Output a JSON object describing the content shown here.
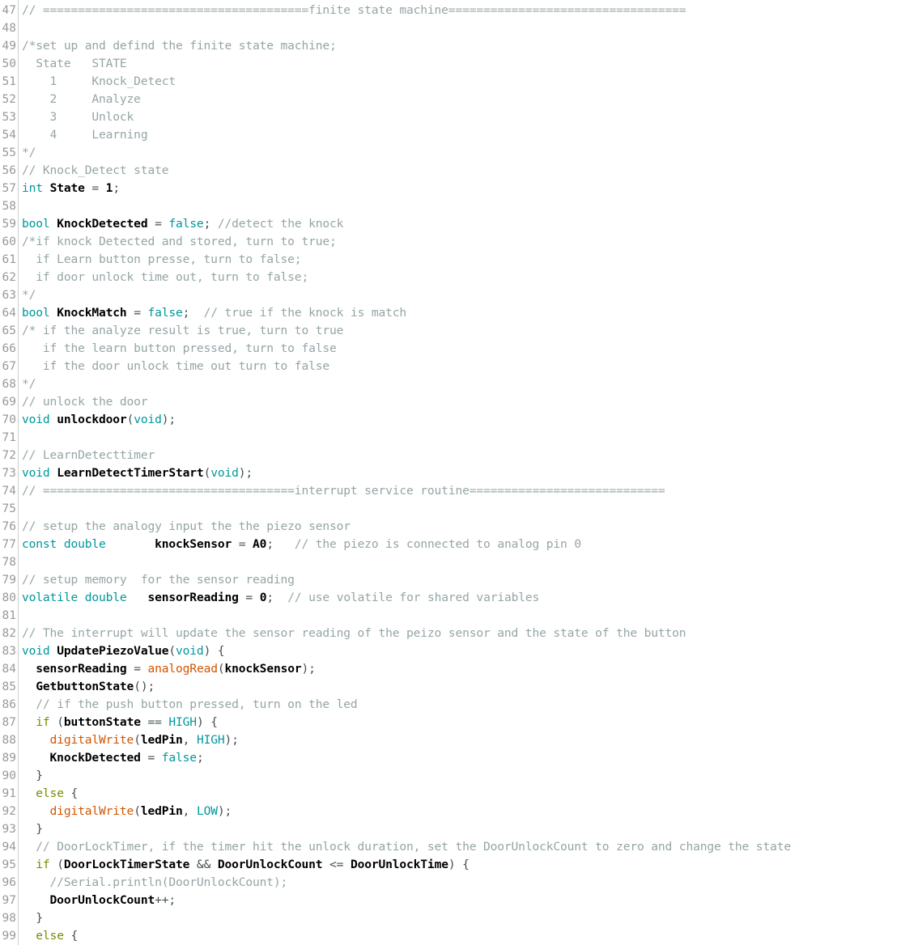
{
  "editor": {
    "name": "arduino-code-editor",
    "language": "C++ (Arduino)",
    "first_line": 47,
    "last_line": 99,
    "colors": {
      "background": "#ffffff",
      "gutter_text": "#999999",
      "gutter_border": "#cfcfcf",
      "comment": "#95a5a6",
      "keyword": "#00979c",
      "literal": "#00979c",
      "function": "#d35400",
      "control": "#728e00",
      "identifier": "#000000",
      "operator": "#434f54"
    }
  },
  "lines": [
    {
      "n": "47",
      "tokens": [
        {
          "t": "// ======================================finite state machine==================================",
          "c": "cmt"
        }
      ]
    },
    {
      "n": "48",
      "tokens": []
    },
    {
      "n": "49",
      "tokens": [
        {
          "t": "/*set up and defind the finite state machine;",
          "c": "cmt"
        }
      ]
    },
    {
      "n": "50",
      "tokens": [
        {
          "t": "  State   STATE",
          "c": "cmt"
        }
      ]
    },
    {
      "n": "51",
      "tokens": [
        {
          "t": "    1     Knock_Detect",
          "c": "cmt"
        }
      ]
    },
    {
      "n": "52",
      "tokens": [
        {
          "t": "    2     Analyze",
          "c": "cmt"
        }
      ]
    },
    {
      "n": "53",
      "tokens": [
        {
          "t": "    3     Unlock",
          "c": "cmt"
        }
      ]
    },
    {
      "n": "54",
      "tokens": [
        {
          "t": "    4     Learning",
          "c": "cmt"
        }
      ]
    },
    {
      "n": "55",
      "tokens": [
        {
          "t": "*/",
          "c": "cmt"
        }
      ]
    },
    {
      "n": "56",
      "tokens": [
        {
          "t": "// Knock_Detect state",
          "c": "cmt"
        }
      ]
    },
    {
      "n": "57",
      "tokens": [
        {
          "t": "int",
          "c": "kw"
        },
        {
          "t": " ",
          "c": "op"
        },
        {
          "t": "State",
          "c": "id"
        },
        {
          "t": " = ",
          "c": "op"
        },
        {
          "t": "1",
          "c": "num"
        },
        {
          "t": ";",
          "c": "op"
        }
      ]
    },
    {
      "n": "58",
      "tokens": []
    },
    {
      "n": "59",
      "tokens": [
        {
          "t": "bool",
          "c": "kw"
        },
        {
          "t": " ",
          "c": "op"
        },
        {
          "t": "KnockDetected",
          "c": "id"
        },
        {
          "t": " = ",
          "c": "op"
        },
        {
          "t": "false",
          "c": "lit"
        },
        {
          "t": "; ",
          "c": "op"
        },
        {
          "t": "//detect the knock",
          "c": "cmt"
        }
      ]
    },
    {
      "n": "60",
      "tokens": [
        {
          "t": "/*if knock Detected and stored, turn to true;",
          "c": "cmt"
        }
      ]
    },
    {
      "n": "61",
      "tokens": [
        {
          "t": "  if Learn button presse, turn to false;",
          "c": "cmt"
        }
      ]
    },
    {
      "n": "62",
      "tokens": [
        {
          "t": "  if door unlock time out, turn to false;",
          "c": "cmt"
        }
      ]
    },
    {
      "n": "63",
      "tokens": [
        {
          "t": "*/",
          "c": "cmt"
        }
      ]
    },
    {
      "n": "64",
      "tokens": [
        {
          "t": "bool",
          "c": "kw"
        },
        {
          "t": " ",
          "c": "op"
        },
        {
          "t": "KnockMatch",
          "c": "id"
        },
        {
          "t": " = ",
          "c": "op"
        },
        {
          "t": "false",
          "c": "lit"
        },
        {
          "t": ";  ",
          "c": "op"
        },
        {
          "t": "// true if the knock is match",
          "c": "cmt"
        }
      ]
    },
    {
      "n": "65",
      "tokens": [
        {
          "t": "/* if the analyze result is true, turn to true",
          "c": "cmt"
        }
      ]
    },
    {
      "n": "66",
      "tokens": [
        {
          "t": "   if the learn button pressed, turn to false",
          "c": "cmt"
        }
      ]
    },
    {
      "n": "67",
      "tokens": [
        {
          "t": "   if the door unlock time out turn to false",
          "c": "cmt"
        }
      ]
    },
    {
      "n": "68",
      "tokens": [
        {
          "t": "*/",
          "c": "cmt"
        }
      ]
    },
    {
      "n": "69",
      "tokens": [
        {
          "t": "// unlock the door",
          "c": "cmt"
        }
      ]
    },
    {
      "n": "70",
      "tokens": [
        {
          "t": "void",
          "c": "kw"
        },
        {
          "t": " ",
          "c": "op"
        },
        {
          "t": "unlockdoor",
          "c": "id"
        },
        {
          "t": "(",
          "c": "op"
        },
        {
          "t": "void",
          "c": "kw"
        },
        {
          "t": ");",
          "c": "op"
        }
      ]
    },
    {
      "n": "71",
      "tokens": []
    },
    {
      "n": "72",
      "tokens": [
        {
          "t": "// LearnDetecttimer",
          "c": "cmt"
        }
      ]
    },
    {
      "n": "73",
      "tokens": [
        {
          "t": "void",
          "c": "kw"
        },
        {
          "t": " ",
          "c": "op"
        },
        {
          "t": "LearnDetectTimerStart",
          "c": "id"
        },
        {
          "t": "(",
          "c": "op"
        },
        {
          "t": "void",
          "c": "kw"
        },
        {
          "t": ");",
          "c": "op"
        }
      ]
    },
    {
      "n": "74",
      "tokens": [
        {
          "t": "// ====================================interrupt service routine============================",
          "c": "cmt"
        }
      ]
    },
    {
      "n": "75",
      "tokens": []
    },
    {
      "n": "76",
      "tokens": [
        {
          "t": "// setup the analogy input the the piezo sensor",
          "c": "cmt"
        }
      ]
    },
    {
      "n": "77",
      "tokens": [
        {
          "t": "const",
          "c": "kw"
        },
        {
          "t": " ",
          "c": "op"
        },
        {
          "t": "double",
          "c": "kw"
        },
        {
          "t": "       ",
          "c": "op"
        },
        {
          "t": "knockSensor",
          "c": "id"
        },
        {
          "t": " = ",
          "c": "op"
        },
        {
          "t": "A0",
          "c": "id"
        },
        {
          "t": ";   ",
          "c": "op"
        },
        {
          "t": "// the piezo is connected to analog pin 0",
          "c": "cmt"
        }
      ]
    },
    {
      "n": "78",
      "tokens": []
    },
    {
      "n": "79",
      "tokens": [
        {
          "t": "// setup memory  for the sensor reading",
          "c": "cmt"
        }
      ]
    },
    {
      "n": "80",
      "tokens": [
        {
          "t": "volatile",
          "c": "kw"
        },
        {
          "t": " ",
          "c": "op"
        },
        {
          "t": "double",
          "c": "kw"
        },
        {
          "t": "   ",
          "c": "op"
        },
        {
          "t": "sensorReading",
          "c": "id"
        },
        {
          "t": " = ",
          "c": "op"
        },
        {
          "t": "0",
          "c": "num"
        },
        {
          "t": ";  ",
          "c": "op"
        },
        {
          "t": "// use volatile for shared variables",
          "c": "cmt"
        }
      ]
    },
    {
      "n": "81",
      "tokens": []
    },
    {
      "n": "82",
      "tokens": [
        {
          "t": "// The interrupt will update the sensor reading of the peizo sensor and the state of the button",
          "c": "cmt"
        }
      ]
    },
    {
      "n": "83",
      "tokens": [
        {
          "t": "void",
          "c": "kw"
        },
        {
          "t": " ",
          "c": "op"
        },
        {
          "t": "UpdatePiezoValue",
          "c": "id"
        },
        {
          "t": "(",
          "c": "op"
        },
        {
          "t": "void",
          "c": "kw"
        },
        {
          "t": ") {",
          "c": "op"
        }
      ]
    },
    {
      "n": "84",
      "tokens": [
        {
          "t": "  ",
          "c": "op"
        },
        {
          "t": "sensorReading",
          "c": "id"
        },
        {
          "t": " = ",
          "c": "op"
        },
        {
          "t": "analogRead",
          "c": "fn"
        },
        {
          "t": "(",
          "c": "op"
        },
        {
          "t": "knockSensor",
          "c": "id"
        },
        {
          "t": ");",
          "c": "op"
        }
      ]
    },
    {
      "n": "85",
      "tokens": [
        {
          "t": "  ",
          "c": "op"
        },
        {
          "t": "GetbuttonState",
          "c": "id"
        },
        {
          "t": "();",
          "c": "op"
        }
      ]
    },
    {
      "n": "86",
      "tokens": [
        {
          "t": "  ",
          "c": "op"
        },
        {
          "t": "// if the push button pressed, turn on the led",
          "c": "cmt"
        }
      ]
    },
    {
      "n": "87",
      "tokens": [
        {
          "t": "  ",
          "c": "op"
        },
        {
          "t": "if",
          "c": "ctl"
        },
        {
          "t": " (",
          "c": "op"
        },
        {
          "t": "buttonState",
          "c": "id"
        },
        {
          "t": " == ",
          "c": "op"
        },
        {
          "t": "HIGH",
          "c": "lit"
        },
        {
          "t": ") {",
          "c": "op"
        }
      ]
    },
    {
      "n": "88",
      "tokens": [
        {
          "t": "    ",
          "c": "op"
        },
        {
          "t": "digitalWrite",
          "c": "fn"
        },
        {
          "t": "(",
          "c": "op"
        },
        {
          "t": "ledPin",
          "c": "id"
        },
        {
          "t": ", ",
          "c": "op"
        },
        {
          "t": "HIGH",
          "c": "lit"
        },
        {
          "t": ");",
          "c": "op"
        }
      ]
    },
    {
      "n": "89",
      "tokens": [
        {
          "t": "    ",
          "c": "op"
        },
        {
          "t": "KnockDetected",
          "c": "id"
        },
        {
          "t": " = ",
          "c": "op"
        },
        {
          "t": "false",
          "c": "lit"
        },
        {
          "t": ";",
          "c": "op"
        }
      ]
    },
    {
      "n": "90",
      "tokens": [
        {
          "t": "  }",
          "c": "op"
        }
      ]
    },
    {
      "n": "91",
      "tokens": [
        {
          "t": "  ",
          "c": "op"
        },
        {
          "t": "else",
          "c": "ctl"
        },
        {
          "t": " {",
          "c": "op"
        }
      ]
    },
    {
      "n": "92",
      "tokens": [
        {
          "t": "    ",
          "c": "op"
        },
        {
          "t": "digitalWrite",
          "c": "fn"
        },
        {
          "t": "(",
          "c": "op"
        },
        {
          "t": "ledPin",
          "c": "id"
        },
        {
          "t": ", ",
          "c": "op"
        },
        {
          "t": "LOW",
          "c": "lit"
        },
        {
          "t": ");",
          "c": "op"
        }
      ]
    },
    {
      "n": "93",
      "tokens": [
        {
          "t": "  }",
          "c": "op"
        }
      ]
    },
    {
      "n": "94",
      "tokens": [
        {
          "t": "  ",
          "c": "op"
        },
        {
          "t": "// DoorLockTimer, if the timer hit the unlock duration, set the DoorUnlockCount to zero and change the state",
          "c": "cmt"
        }
      ]
    },
    {
      "n": "95",
      "tokens": [
        {
          "t": "  ",
          "c": "op"
        },
        {
          "t": "if",
          "c": "ctl"
        },
        {
          "t": " (",
          "c": "op"
        },
        {
          "t": "DoorLockTimerState",
          "c": "id"
        },
        {
          "t": " && ",
          "c": "op"
        },
        {
          "t": "DoorUnlockCount",
          "c": "id"
        },
        {
          "t": " <= ",
          "c": "op"
        },
        {
          "t": "DoorUnlockTime",
          "c": "id"
        },
        {
          "t": ") {",
          "c": "op"
        }
      ]
    },
    {
      "n": "96",
      "tokens": [
        {
          "t": "    ",
          "c": "op"
        },
        {
          "t": "//Serial.println(DoorUnlockCount);",
          "c": "cmt"
        }
      ]
    },
    {
      "n": "97",
      "tokens": [
        {
          "t": "    ",
          "c": "op"
        },
        {
          "t": "DoorUnlockCount",
          "c": "id"
        },
        {
          "t": "++;",
          "c": "op"
        }
      ]
    },
    {
      "n": "98",
      "tokens": [
        {
          "t": "  }",
          "c": "op"
        }
      ]
    },
    {
      "n": "99",
      "tokens": [
        {
          "t": "  ",
          "c": "op"
        },
        {
          "t": "else",
          "c": "ctl"
        },
        {
          "t": " {",
          "c": "op"
        }
      ]
    }
  ]
}
